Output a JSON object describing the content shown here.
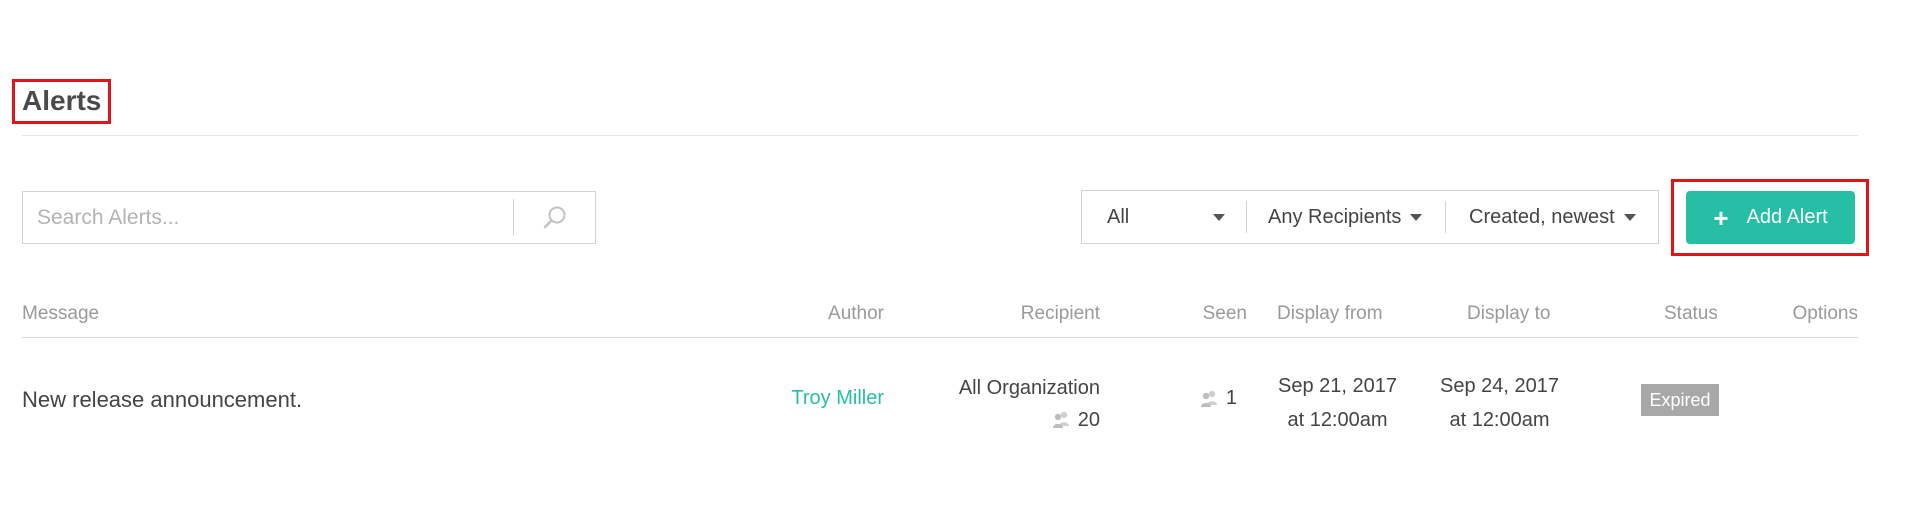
{
  "page": {
    "title": "Alerts"
  },
  "search": {
    "placeholder": "Search Alerts...",
    "icon": "search-icon"
  },
  "filters": {
    "type": {
      "selected": "All"
    },
    "recipients": {
      "selected": "Any Recipients"
    },
    "sort": {
      "selected": "Created, newest"
    }
  },
  "add_button": {
    "label": "Add Alert",
    "icon": "plus-icon",
    "color": "#26bfa5"
  },
  "table": {
    "columns": {
      "message": "Message",
      "author": "Author",
      "recipient": "Recipient",
      "seen": "Seen",
      "display_from": "Display from",
      "display_to": "Display to",
      "status": "Status",
      "options": "Options"
    },
    "rows": [
      {
        "message": "New release announcement.",
        "author": "Troy Miller",
        "recipient": "All Organization",
        "recipient_count": "20",
        "seen": "1",
        "display_from_date": "Sep 21, 2017",
        "display_from_time": "at 12:00am",
        "display_to_date": "Sep 24, 2017",
        "display_to_time": "at 12:00am",
        "status": "Expired"
      }
    ]
  },
  "colors": {
    "accent": "#26bfa5",
    "status_expired": "#a8a8a8",
    "highlight": "#e0151a"
  }
}
